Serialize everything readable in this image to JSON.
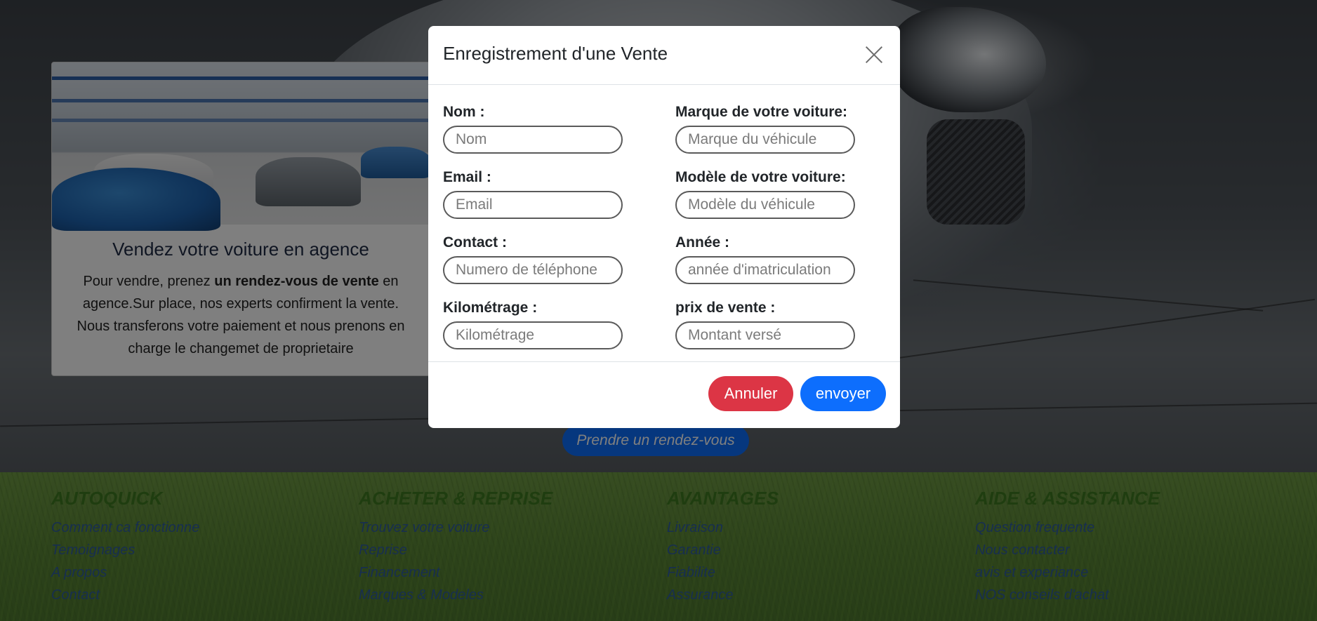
{
  "background": {
    "card": {
      "title": "Vendez votre voiture en agence",
      "text_1": "Pour vendre, prenez ",
      "text_bold": "un rendez-vous de vente",
      "text_2": " en agence.Sur place, nos experts confirment la vente. Nous transferons votre paiement et nous prenons en charge le changemet de proprietaire"
    },
    "cta_button": "Prendre un rendez-vous"
  },
  "footer": {
    "columns": [
      {
        "heading": "AUTOQUICK",
        "links": [
          "Comment ca fonctionne",
          "Temoignages",
          "A propos",
          "Contact"
        ]
      },
      {
        "heading": "ACHETER & REPRISE",
        "links": [
          "Trouvez votre voiture",
          "Reprise",
          "Financement",
          "Marques & Modeles"
        ]
      },
      {
        "heading": "AVANTAGES",
        "links": [
          "Livraison",
          "Garantie",
          "Fiabilite",
          "Assurance"
        ]
      },
      {
        "heading": "AIDE & ASSISTANCE",
        "links": [
          "Question frequente",
          "Nous contacter",
          "avis et experiance",
          "NOS conseils d'achat"
        ]
      }
    ]
  },
  "modal": {
    "title": "Enregistrement d'une Vente",
    "fields": {
      "nom": {
        "label": "Nom :",
        "placeholder": "Nom",
        "value": ""
      },
      "email": {
        "label": "Email :",
        "placeholder": "Email",
        "value": ""
      },
      "contact": {
        "label": "Contact :",
        "placeholder": "Numero de téléphone",
        "value": ""
      },
      "kilometrage": {
        "label": "Kilométrage :",
        "placeholder": "Kilométrage",
        "value": ""
      },
      "marque": {
        "label": "Marque de votre voiture:",
        "placeholder": "Marque du véhicule",
        "value": ""
      },
      "modele": {
        "label": "Modèle de votre voiture:",
        "placeholder": "Modèle du véhicule",
        "value": ""
      },
      "annee": {
        "label": "Année :",
        "placeholder": "année d'imatriculation",
        "value": ""
      },
      "prix": {
        "label": "prix de vente :",
        "placeholder": "Montant versé",
        "value": ""
      }
    },
    "cancel_label": "Annuler",
    "submit_label": "envoyer"
  },
  "colors": {
    "primary": "#0d6efd",
    "danger": "#dc3545",
    "footer_heading": "#3f7a20",
    "footer_link": "#2f5da0"
  }
}
